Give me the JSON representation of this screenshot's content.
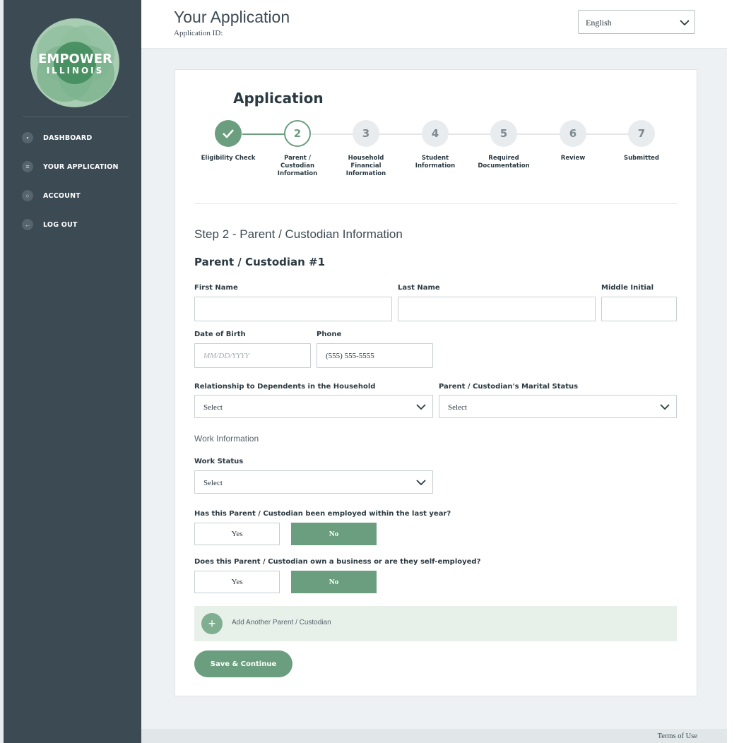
{
  "sidebar": {
    "logo": {
      "line1": "EMPOWER",
      "line2": "ILLINOIS"
    },
    "nav": [
      {
        "label": "DASHBOARD",
        "icon": "grid-icon"
      },
      {
        "label": "YOUR APPLICATION",
        "icon": "list-icon"
      },
      {
        "label": "ACCOUNT",
        "icon": "user-icon"
      },
      {
        "label": "LOG OUT",
        "icon": "arrow-left-icon"
      }
    ]
  },
  "header": {
    "title": "Your Application",
    "app_id_label": "Application ID:",
    "language": "English"
  },
  "form": {
    "title": "Application",
    "steps": [
      {
        "number": "",
        "label": "Eligibility Check",
        "status": "complete"
      },
      {
        "number": "2",
        "label": "Parent / Custodian Information",
        "status": "current"
      },
      {
        "number": "3",
        "label": "Household Financial Information",
        "status": "upcoming"
      },
      {
        "number": "4",
        "label": "Student Information",
        "status": "upcoming"
      },
      {
        "number": "5",
        "label": "Required Documentation",
        "status": "upcoming"
      },
      {
        "number": "6",
        "label": "Review",
        "status": "upcoming"
      },
      {
        "number": "7",
        "label": "Submitted",
        "status": "upcoming"
      }
    ],
    "step_heading": "Step 2 - Parent / Custodian Information",
    "section_heading": "Parent / Custodian #1",
    "fields": {
      "first_name_label": "First Name",
      "first_name_value": "",
      "last_name_label": "Last Name",
      "last_name_value": "",
      "middle_initial_label": "Middle Initial",
      "middle_initial_value": "",
      "dob_label": "Date of Birth",
      "dob_placeholder": "MM/DD/YYYY",
      "phone_label": "Phone",
      "phone_value": "(555) 555-5555",
      "relationship_label": "Relationship to Dependents in the Household",
      "relationship_value": "Select",
      "marital_label": "Parent / Custodian's Marital Status",
      "marital_value": "Select",
      "work_info_heading": "Work Information",
      "work_status_label": "Work Status",
      "work_status_value": "Select"
    },
    "questions": [
      {
        "text": "Has this Parent / Custodian been employed within the last year?",
        "yes": "Yes",
        "no": "No",
        "selected": "No"
      },
      {
        "text": "Does this Parent / Custodian own a business or are they self-employed?",
        "yes": "Yes",
        "no": "No",
        "selected": "No"
      }
    ],
    "add_parent": "Add Another Parent / Custodian",
    "save_button": "Save & Continue"
  },
  "footer": {
    "terms": "Terms of Use"
  },
  "colors": {
    "sidebar": "#3c4a54",
    "accent": "#6a9e7e",
    "page_bg": "#edf1f3"
  }
}
